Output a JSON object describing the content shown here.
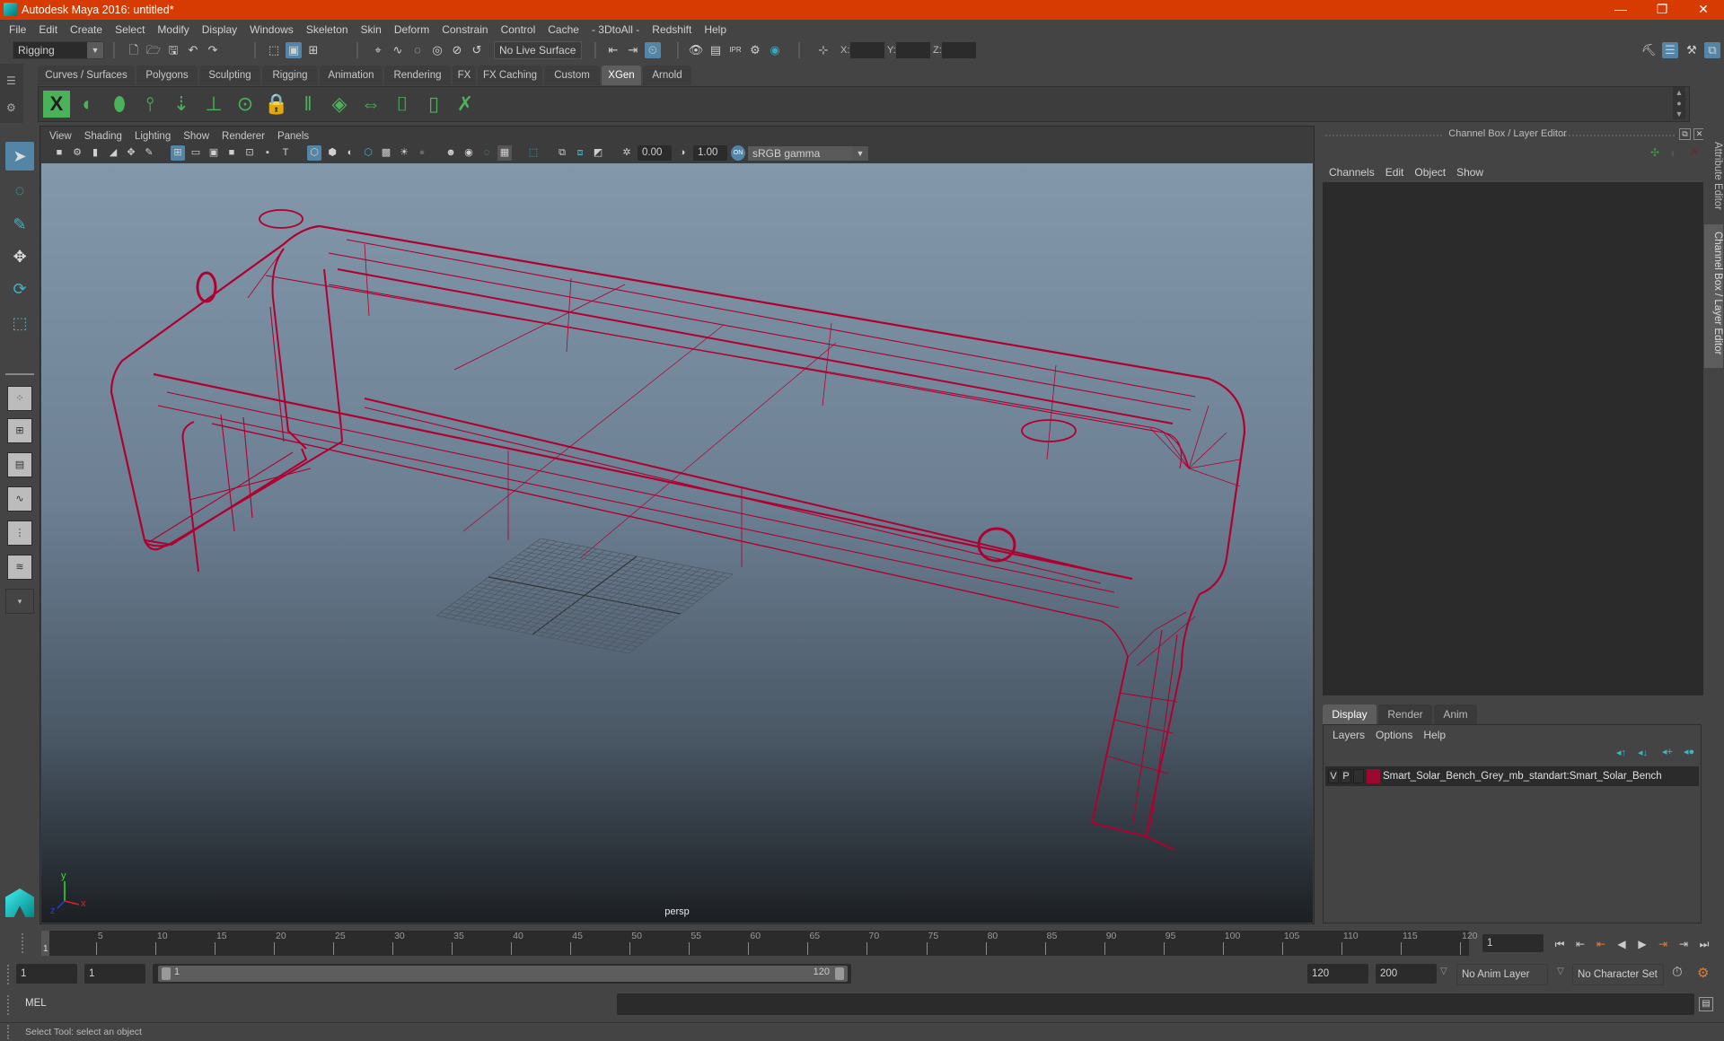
{
  "window": {
    "title": "Autodesk Maya 2016: untitled*",
    "controls": {
      "minimize": "—",
      "restore": "❐",
      "close": "✕"
    }
  },
  "menubar": [
    "File",
    "Edit",
    "Create",
    "Select",
    "Modify",
    "Display",
    "Windows",
    "Skeleton",
    "Skin",
    "Deform",
    "Constrain",
    "Control",
    "Cache",
    "- 3DtoAll -",
    "Redshift",
    "Help"
  ],
  "statusline": {
    "menu_set": "Rigging",
    "live_surface": "No Live Surface",
    "xyz_labels": [
      "X:",
      "Y:",
      "Z:"
    ],
    "xyz_values": [
      "",
      "",
      ""
    ]
  },
  "shelf": {
    "tabs": [
      "Curves / Surfaces",
      "Polygons",
      "Sculpting",
      "Rigging",
      "Animation",
      "Rendering",
      "FX",
      "FX Caching",
      "Custom",
      "XGen",
      "Arnold"
    ],
    "active_tab": "XGen",
    "icons": [
      "xgen-editor-icon",
      "create-description-icon",
      "create-collection-icon",
      "add-guides-icon",
      "move-guides-icon",
      "add-guide-icon",
      "toggle-guide-visibility-icon",
      "lock-guide-icon",
      "guide-length-icon",
      "sculpt-guides-icon",
      "rebuild-guides-icon",
      "select-guides-icon",
      "guide-bounds-icon",
      "delete-guides-icon"
    ]
  },
  "viewport": {
    "menu": [
      "View",
      "Shading",
      "Lighting",
      "Show",
      "Renderer",
      "Panels"
    ],
    "exposure": "0.00",
    "gamma": "1.00",
    "color_mgmt_toggle": "ON",
    "color_space": "sRGB gamma",
    "camera_label": "persp",
    "axis": {
      "x": "x",
      "y": "y",
      "z": "z"
    },
    "wire_color": "#b0002f"
  },
  "channel_box": {
    "title": "Channel Box / Layer Editor",
    "menu": [
      "Channels",
      "Edit",
      "Object",
      "Show"
    ]
  },
  "layer_editor": {
    "tabs": [
      "Display",
      "Render",
      "Anim"
    ],
    "active_tab": "Display",
    "menu": [
      "Layers",
      "Options",
      "Help"
    ],
    "layers": [
      {
        "visible": "V",
        "playback": "P",
        "color": "#9b0a2e",
        "name": "Smart_Solar_Bench_Grey_mb_standart:Smart_Solar_Bench"
      }
    ]
  },
  "side_tabs": [
    "Attribute Editor",
    "Channel Box / Layer Editor"
  ],
  "timeline": {
    "ticks": [
      5,
      10,
      15,
      20,
      25,
      30,
      35,
      40,
      45,
      50,
      55,
      60,
      65,
      70,
      75,
      80,
      85,
      90,
      95,
      100,
      105,
      110,
      115,
      120
    ],
    "current_frame_marker": "1",
    "current_frame": "1"
  },
  "range": {
    "start_time": "1",
    "playback_start": "1",
    "slider_start": "1",
    "slider_end": "120",
    "playback_end": "120",
    "end_time": "200",
    "anim_layer": "No Anim Layer",
    "character_set": "No Character Set"
  },
  "command_line": {
    "label": "MEL",
    "value": ""
  },
  "help_line": "Select Tool: select an object"
}
